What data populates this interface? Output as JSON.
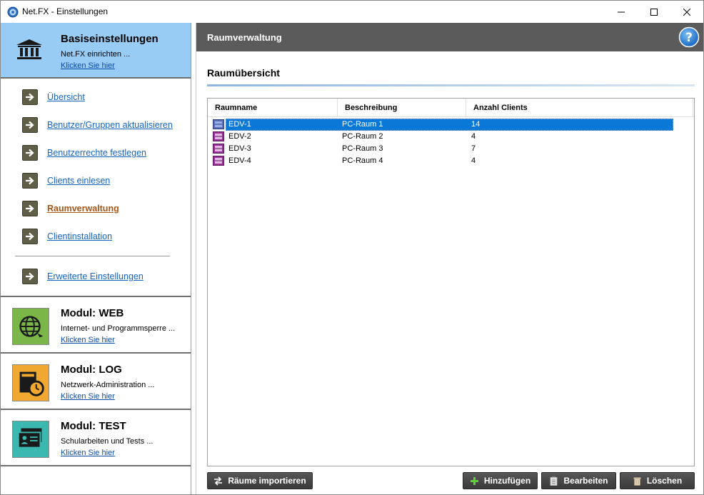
{
  "window": {
    "title": "Net.FX - Einstellungen"
  },
  "sidebar": {
    "base": {
      "title": "Basiseinstellungen",
      "subtitle": "Net.FX einrichten ...",
      "link": "Klicken Sie hier"
    },
    "nav": [
      {
        "label": "Übersicht",
        "active": false
      },
      {
        "label": "Benutzer/Gruppen aktualisieren",
        "active": false
      },
      {
        "label": "Benutzerrechte festlegen",
        "active": false
      },
      {
        "label": "Clients einlesen",
        "active": false
      },
      {
        "label": "Raumverwaltung",
        "active": true
      },
      {
        "label": "Clientinstallation",
        "active": false
      },
      {
        "label": "Erweiterte Einstellungen",
        "active": false
      }
    ],
    "modules": [
      {
        "title": "Modul: WEB",
        "subtitle": "Internet- und Programmsperre ...",
        "link": "Klicken Sie hier",
        "icon": "globe-icon",
        "color": "#7ab648"
      },
      {
        "title": "Modul: LOG",
        "subtitle": "Netzwerk-Administration ...",
        "link": "Klicken Sie hier",
        "icon": "clock-folder-icon",
        "color": "#f0a830"
      },
      {
        "title": "Modul: TEST",
        "subtitle": "Schularbeiten und Tests ...",
        "link": "Klicken Sie hier",
        "icon": "id-card-icon",
        "color": "#3bb8b0"
      }
    ]
  },
  "main": {
    "header": "Raumverwaltung",
    "section_title": "Raumübersicht",
    "table": {
      "columns": [
        "Raumname",
        "Beschreibung",
        "Anzahl Clients"
      ],
      "rows": [
        {
          "name": "EDV-1",
          "description": "PC-Raum 1",
          "clients": "14",
          "selected": true
        },
        {
          "name": "EDV-2",
          "description": "PC-Raum 2",
          "clients": "4",
          "selected": false
        },
        {
          "name": "EDV-3",
          "description": "PC-Raum 3",
          "clients": "7",
          "selected": false
        },
        {
          "name": "EDV-4",
          "description": "PC-Raum 4",
          "clients": "4",
          "selected": false
        }
      ]
    },
    "buttons": {
      "import": "Räume importieren",
      "add": "Hinzufügen",
      "edit": "Bearbeiten",
      "delete": "Löschen"
    }
  },
  "colors": {
    "sidebar_header_bg": "#99ccf5",
    "main_header_bg": "#5b5b5b",
    "link": "#1565c0",
    "active_link": "#a85614",
    "selection": "#0a78d7"
  }
}
